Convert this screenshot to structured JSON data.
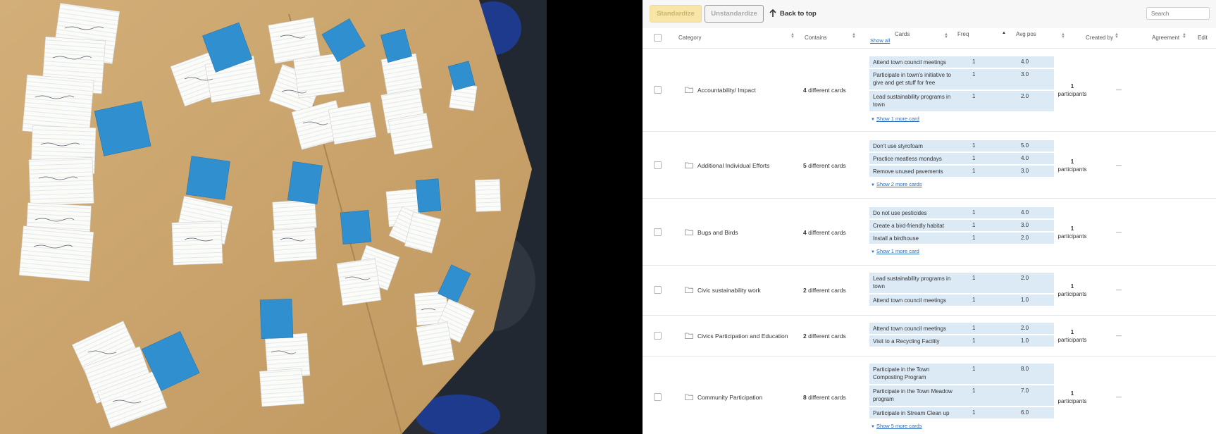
{
  "toolbar": {
    "standardize_label": "Standardize",
    "unstandardize_label": "Unstandardize",
    "back_to_top_label": "Back to top",
    "search_placeholder": "Search"
  },
  "table": {
    "headers": {
      "category": "Category",
      "contains": "Contains",
      "cards": "Cards",
      "freq": "Freq",
      "avg_pos": "Avg pos",
      "created_by": "Created by",
      "agreement": "Agreement",
      "edit": "Edit"
    },
    "show_all_label": "Show all",
    "rows": [
      {
        "category": "Accountability/ Impact",
        "contains_count": "4",
        "contains_suffix": " different cards",
        "cards": [
          {
            "name": "Attend town council meetings",
            "freq": "1",
            "avg": "4.0"
          },
          {
            "name": "Participate in town's initiative to give and get stuff for free",
            "freq": "1",
            "avg": "3.0"
          },
          {
            "name": "Lead sustainability programs in town",
            "freq": "1",
            "avg": "2.0"
          }
        ],
        "more": "Show 1 more card",
        "participants_count": "1",
        "participants_label": "participants",
        "agreement": "—"
      },
      {
        "category": "Additional Individual Efforts",
        "contains_count": "5",
        "contains_suffix": " different cards",
        "cards": [
          {
            "name": "Don't use styrofoam",
            "freq": "1",
            "avg": "5.0"
          },
          {
            "name": "Practice meatless mondays",
            "freq": "1",
            "avg": "4.0"
          },
          {
            "name": "Remove unused pavements",
            "freq": "1",
            "avg": "3.0"
          }
        ],
        "more": "Show 2 more cards",
        "participants_count": "1",
        "participants_label": "participants",
        "agreement": "—"
      },
      {
        "category": "Bugs and Birds",
        "contains_count": "4",
        "contains_suffix": " different cards",
        "cards": [
          {
            "name": "Do not use pesticides",
            "freq": "1",
            "avg": "4.0"
          },
          {
            "name": "Create a bird-friendly habitat",
            "freq": "1",
            "avg": "3.0"
          },
          {
            "name": "Install a birdhouse",
            "freq": "1",
            "avg": "2.0"
          }
        ],
        "more": "Show 1 more card",
        "participants_count": "1",
        "participants_label": "participants",
        "agreement": "—"
      },
      {
        "category": "Civic sustainability work",
        "contains_count": "2",
        "contains_suffix": " different cards",
        "cards": [
          {
            "name": "Lead sustainability programs in town",
            "freq": "1",
            "avg": "2.0"
          },
          {
            "name": "Attend town council meetings",
            "freq": "1",
            "avg": "1.0"
          }
        ],
        "more": "",
        "participants_count": "1",
        "participants_label": "participants",
        "agreement": "—"
      },
      {
        "category": "Civics Participation and Education",
        "contains_count": "2",
        "contains_suffix": " different cards",
        "cards": [
          {
            "name": "Attend town council meetings",
            "freq": "1",
            "avg": "2.0"
          },
          {
            "name": "Visit to a Recycling Facility",
            "freq": "1",
            "avg": "1.0"
          }
        ],
        "more": "",
        "participants_count": "1",
        "participants_label": "participants",
        "agreement": "—"
      },
      {
        "category": "Community Participation",
        "contains_count": "8",
        "contains_suffix": " different cards",
        "cards": [
          {
            "name": "Participate in the Town Composting Program",
            "freq": "1",
            "avg": "8.0"
          },
          {
            "name": "Participate in the Town Meadow program",
            "freq": "1",
            "avg": "7.0"
          },
          {
            "name": "Participate in Stream Clean up",
            "freq": "1",
            "avg": "6.0"
          }
        ],
        "more": "Show 5 more cards",
        "participants_count": "1",
        "participants_label": "participants",
        "agreement": "—"
      }
    ]
  },
  "colors": {
    "accent_link": "#2a6fbf",
    "card_bg": "#dceaf6",
    "standardize_bg": "#f8e6a8",
    "table_surface": "#c9a36b",
    "sticky_note_blue": "#2f8fcf"
  }
}
